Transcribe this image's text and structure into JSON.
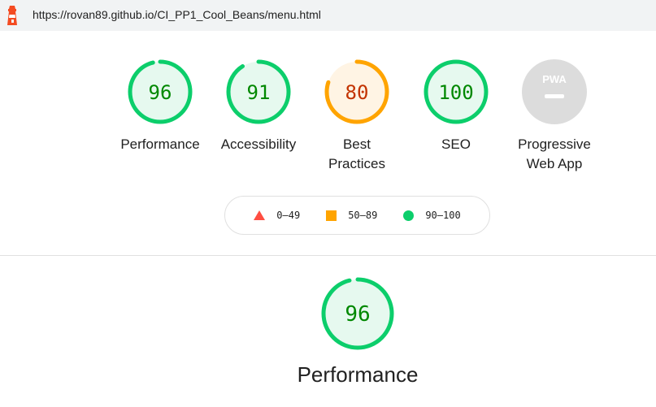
{
  "topbar": {
    "url": "https://rovan89.github.io/CI_PP1_Cool_Beans/menu.html",
    "logo_icon": "lighthouse-icon"
  },
  "colors": {
    "pass": "#0cce6b",
    "pass_bg": "#e6f9ef",
    "average": "#ffa400",
    "average_bg": "#fff4e4",
    "fail": "#ff4e42",
    "pass_text": "#008800",
    "average_text": "#c33300",
    "pwa_gray": "#dcdcdc"
  },
  "categories": [
    {
      "label": "Performance",
      "score": 96
    },
    {
      "label": "Accessibility",
      "score": 91
    },
    {
      "label": "Best\nPractices",
      "score": 80
    },
    {
      "label": "SEO",
      "score": 100
    },
    {
      "label": "Progressive\nWeb App",
      "badge": "PWA"
    }
  ],
  "legend": {
    "fail": "0–49",
    "average": "50–89",
    "pass": "90–100"
  },
  "section": {
    "title": "Performance",
    "score": 96
  }
}
